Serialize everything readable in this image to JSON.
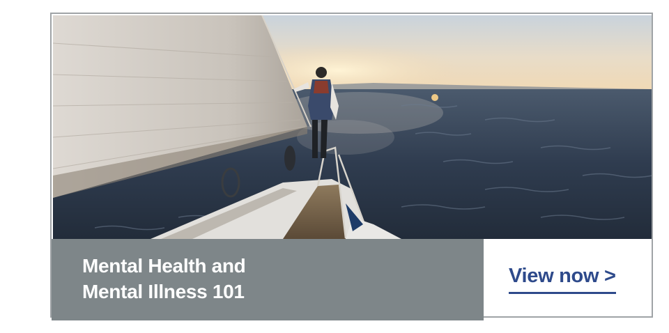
{
  "promo": {
    "image_alt": "Person standing at the bow of a sailboat at sunset on open water",
    "title_line1": "Mental Health and",
    "title_line2": "Mental Illness 101",
    "cta_label": "View now >"
  },
  "colors": {
    "title_panel_bg": "#7e8689",
    "cta_text": "#2e4a8b",
    "card_border": "#9fa3a6"
  }
}
